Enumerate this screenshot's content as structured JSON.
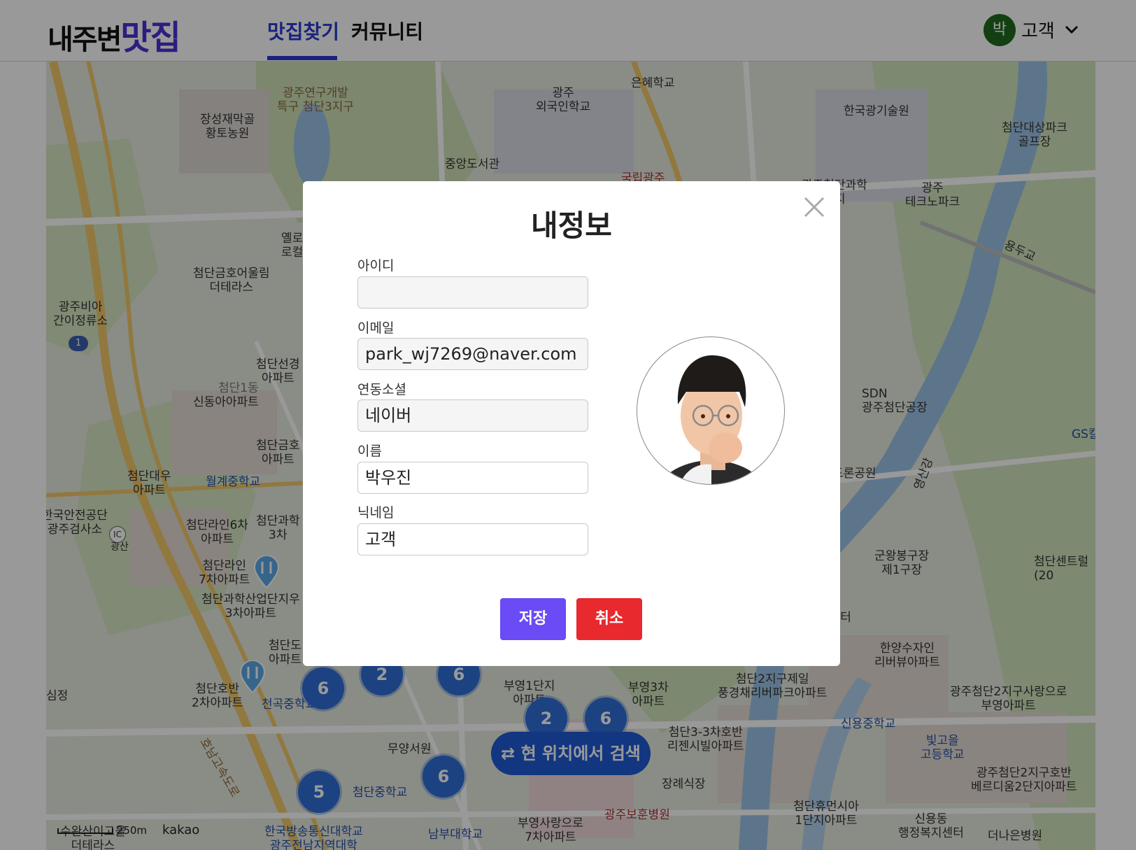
{
  "header": {
    "logo_part1": "내주변",
    "logo_part2": "맛집",
    "nav": [
      {
        "label": "맛집찾기",
        "active": true
      },
      {
        "label": "커뮤니티",
        "active": false
      }
    ],
    "user": {
      "avatar_initial": "박",
      "name": "고객"
    }
  },
  "map": {
    "labels": [
      {
        "text": "광주연구개발\n특구 첨단3지구",
        "style": "brown"
      },
      {
        "text": "광주\n외국인학교",
        "style": ""
      },
      {
        "text": "은혜학교",
        "style": ""
      },
      {
        "text": "한국광기술원",
        "style": ""
      },
      {
        "text": "첨단대상파크\n골프장",
        "style": ""
      },
      {
        "text": "장성재막골\n황토농원",
        "style": ""
      },
      {
        "text": "중앙도서관",
        "style": ""
      },
      {
        "text": "국립광주",
        "style": "red"
      },
      {
        "text": "광주첨단과학\n단지",
        "style": ""
      },
      {
        "text": "광주\n테크노파크",
        "style": ""
      },
      {
        "text": "용두교",
        "style": ""
      },
      {
        "text": "옐로\n로컬",
        "style": ""
      },
      {
        "text": "첨단금호어울림\n더테라스",
        "style": ""
      },
      {
        "text": "광주비아\n간이정류소",
        "style": ""
      },
      {
        "text": "첨단선경\n아파트",
        "style": ""
      },
      {
        "text": "신동아아파트",
        "style": ""
      },
      {
        "text": "첨단금호\n아파트",
        "style": ""
      },
      {
        "text": "SDN\n광주첨단공장",
        "style": ""
      },
      {
        "text": "GS칼",
        "style": "blue"
      },
      {
        "text": "첨단대우\n아파트",
        "style": ""
      },
      {
        "text": "월계중학교",
        "style": "blue"
      },
      {
        "text": "드론공원",
        "style": ""
      },
      {
        "text": "영산강",
        "style": ""
      },
      {
        "text": "한국안전공단\n광주검사소",
        "style": ""
      },
      {
        "text": "첨단라인6차\n아파트",
        "style": ""
      },
      {
        "text": "첨단과학\n3차",
        "style": ""
      },
      {
        "text": "광산",
        "style": ""
      },
      {
        "text": "첨단라인\n7차아파트",
        "style": ""
      },
      {
        "text": "군왕봉구장\n제1구장",
        "style": ""
      },
      {
        "text": "첨단센트럴\n(20",
        "style": ""
      },
      {
        "text": "첨단과학산업단지우\n3차아파트",
        "style": ""
      },
      {
        "text": "이쉼터",
        "style": ""
      },
      {
        "text": "첨단도\n아파트",
        "style": ""
      },
      {
        "text": "한양수자인\n리버뷰아파트",
        "style": ""
      },
      {
        "text": "첨단호반\n2차아파트",
        "style": ""
      },
      {
        "text": "천곡중학교",
        "style": "blue"
      },
      {
        "text": "부영1단지\n아파트",
        "style": ""
      },
      {
        "text": "부영3차\n아파트",
        "style": ""
      },
      {
        "text": "첨단2지구제일\n풍경채리버파크아파트",
        "style": ""
      },
      {
        "text": "광주첨단2지구사랑으로\n부영아파트",
        "style": ""
      },
      {
        "text": "심정",
        "style": ""
      },
      {
        "text": "무양서원",
        "style": ""
      },
      {
        "text": "첨단3-3차호반\n리젠시빌아파트",
        "style": ""
      },
      {
        "text": "신용중학교",
        "style": "blue"
      },
      {
        "text": "빛고을\n고등학교",
        "style": "blue"
      },
      {
        "text": "광주첨단2지구호반\n베르디움2단지아파트",
        "style": ""
      },
      {
        "text": "첨단중학교",
        "style": "blue"
      },
      {
        "text": "장례식장",
        "style": ""
      },
      {
        "text": "광주보훈병원",
        "style": "red"
      },
      {
        "text": "첨단휴먼시아\n1단지아파트",
        "style": ""
      },
      {
        "text": "신용동\n행정복지센터",
        "style": ""
      },
      {
        "text": "한국방송통신대학교\n광주전남지역대학",
        "style": "blue"
      },
      {
        "text": "남부대학교",
        "style": "blue"
      },
      {
        "text": "부영사랑으로\n7차아파트",
        "style": ""
      },
      {
        "text": "더나은병원",
        "style": ""
      },
      {
        "text": "수완산이고을\n더테라스",
        "style": ""
      },
      {
        "text": "첨단1동",
        "style": ""
      }
    ],
    "clusters": [
      "6",
      "2",
      "6",
      "2",
      "6",
      "6",
      "5"
    ],
    "search_button": "현 위치에서 검색",
    "scale": "250m",
    "provider": "kakao",
    "road_badge": "1",
    "ic_badge": "IC",
    "highway": "호남고속도로"
  },
  "modal": {
    "title": "내정보",
    "fields": [
      {
        "label": "아이디",
        "value": "",
        "editable": false
      },
      {
        "label": "이메일",
        "value": "park_wj7269@naver.com",
        "editable": false
      },
      {
        "label": "연동소셜",
        "value": "네이버",
        "editable": false
      },
      {
        "label": "이름",
        "value": "박우진",
        "editable": true
      },
      {
        "label": "닉네임",
        "value": "고객",
        "editable": true
      }
    ],
    "save_label": "저장",
    "cancel_label": "취소"
  },
  "colors": {
    "brand": "#4b2fd6",
    "nav_active": "#2a3ad0",
    "save": "#6a4bf5",
    "cancel": "#e8292e",
    "cluster": "#2f6fd8"
  }
}
